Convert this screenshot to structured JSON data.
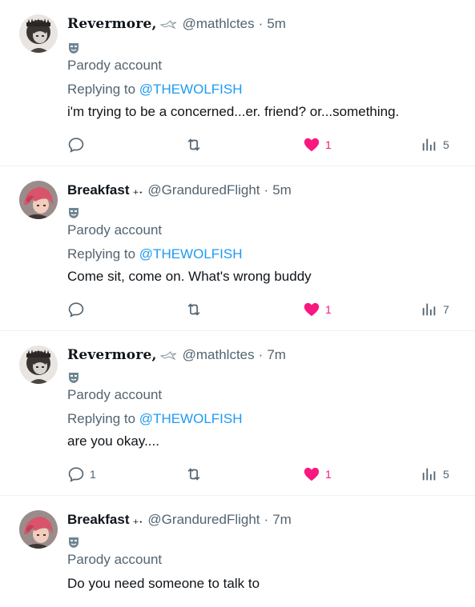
{
  "colors": {
    "accent": "#1d9bf0",
    "like": "#f91880",
    "muted": "#536471",
    "text": "#0f1419"
  },
  "tweets": [
    {
      "display_name": "Revermore,",
      "name_emoji": "🦅",
      "handle": "@mathlctes",
      "separator": "·",
      "time": "5m",
      "parody_label": "Parody account",
      "replying_prefix": "Replying to",
      "replying_to": "@THEWOLFISH",
      "text": "i'm trying to be a concerned...er. friend? or...something.",
      "reply_count": "",
      "retweet_count": "",
      "like_count": "1",
      "view_count": "5",
      "liked": true
    },
    {
      "display_name": "Breakfast",
      "name_emoji": "₊˖",
      "handle": "@GranduredFlight",
      "separator": "·",
      "time": "5m",
      "parody_label": "Parody account",
      "replying_prefix": "Replying to",
      "replying_to": "@THEWOLFISH",
      "text": "Come sit, come on. What's wrong buddy",
      "reply_count": "",
      "retweet_count": "",
      "like_count": "1",
      "view_count": "7",
      "liked": true
    },
    {
      "display_name": "Revermore,",
      "name_emoji": "🦅",
      "handle": "@mathlctes",
      "separator": "·",
      "time": "7m",
      "parody_label": "Parody account",
      "replying_prefix": "Replying to",
      "replying_to": "@THEWOLFISH",
      "text": "are you okay....",
      "reply_count": "1",
      "retweet_count": "",
      "like_count": "1",
      "view_count": "5",
      "liked": true
    },
    {
      "display_name": "Breakfast",
      "name_emoji": "₊˖",
      "handle": "@GranduredFlight",
      "separator": "·",
      "time": "7m",
      "parody_label": "Parody account",
      "text": "Do you need someone to talk to"
    }
  ]
}
